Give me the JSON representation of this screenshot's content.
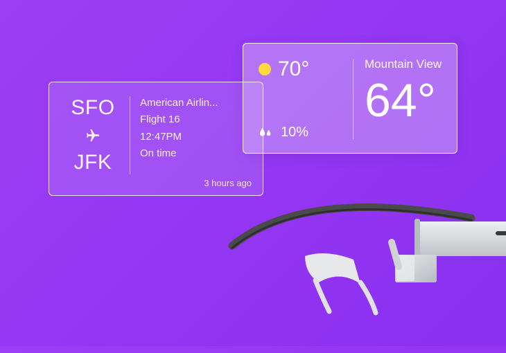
{
  "flight": {
    "origin": "SFO",
    "destination": "JFK",
    "airline": "American Airlin...",
    "flight_number": "Flight 16",
    "departure_time": "12:47PM",
    "status": "On time",
    "timestamp": "3 hours ago"
  },
  "weather": {
    "high_temp": "70°",
    "precipitation": "10%",
    "location": "Mountain View",
    "current_temp": "64°"
  }
}
